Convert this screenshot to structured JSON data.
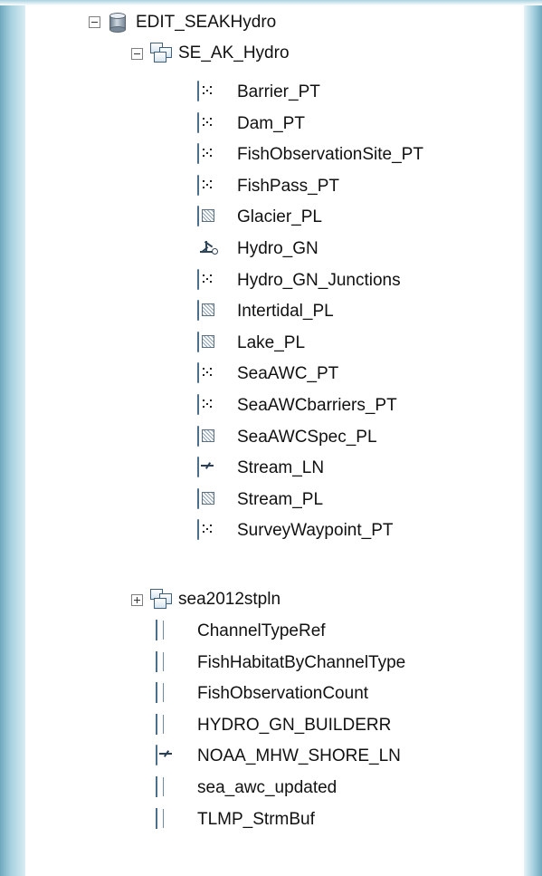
{
  "tree": {
    "root": {
      "label": "EDIT_SEAKHydro",
      "icon": "geodatabase-icon",
      "expanded": true
    },
    "dataset": {
      "label": "SE_AK_Hydro",
      "icon": "feature-dataset-icon",
      "expanded": true
    },
    "feature_classes": [
      {
        "label": "Barrier_PT",
        "icon": "point-feature-class-icon"
      },
      {
        "label": "Dam_PT",
        "icon": "point-feature-class-icon"
      },
      {
        "label": "FishObservationSite_PT",
        "icon": "point-feature-class-icon"
      },
      {
        "label": "FishPass_PT",
        "icon": "point-feature-class-icon"
      },
      {
        "label": "Glacier_PL",
        "icon": "polygon-feature-class-icon"
      },
      {
        "label": "Hydro_GN",
        "icon": "geometric-network-icon"
      },
      {
        "label": "Hydro_GN_Junctions",
        "icon": "point-feature-class-icon"
      },
      {
        "label": "Intertidal_PL",
        "icon": "polygon-feature-class-icon"
      },
      {
        "label": "Lake_PL",
        "icon": "polygon-feature-class-icon"
      },
      {
        "label": "SeaAWC_PT",
        "icon": "point-feature-class-icon"
      },
      {
        "label": "SeaAWCbarriers_PT",
        "icon": "point-feature-class-icon"
      },
      {
        "label": "SeaAWCSpec_PL",
        "icon": "polygon-feature-class-icon"
      },
      {
        "label": "Stream_LN",
        "icon": "line-feature-class-icon"
      },
      {
        "label": "Stream_PL",
        "icon": "polygon-feature-class-icon"
      },
      {
        "label": "SurveyWaypoint_PT",
        "icon": "point-feature-class-icon"
      }
    ],
    "dataset2": {
      "label": "sea2012stpln",
      "icon": "feature-dataset-icon",
      "expanded": false
    },
    "tables": [
      {
        "label": "ChannelTypeRef",
        "icon": "table-icon"
      },
      {
        "label": "FishHabitatByChannelType",
        "icon": "table-icon"
      },
      {
        "label": "FishObservationCount",
        "icon": "table-icon"
      },
      {
        "label": "HYDRO_GN_BUILDERR",
        "icon": "table-icon"
      },
      {
        "label": "NOAA_MHW_SHORE_LN",
        "icon": "line-feature-class-icon"
      },
      {
        "label": "sea_awc_updated",
        "icon": "table-icon"
      },
      {
        "label": "TLMP_StrmBuf",
        "icon": "table-icon"
      }
    ]
  }
}
